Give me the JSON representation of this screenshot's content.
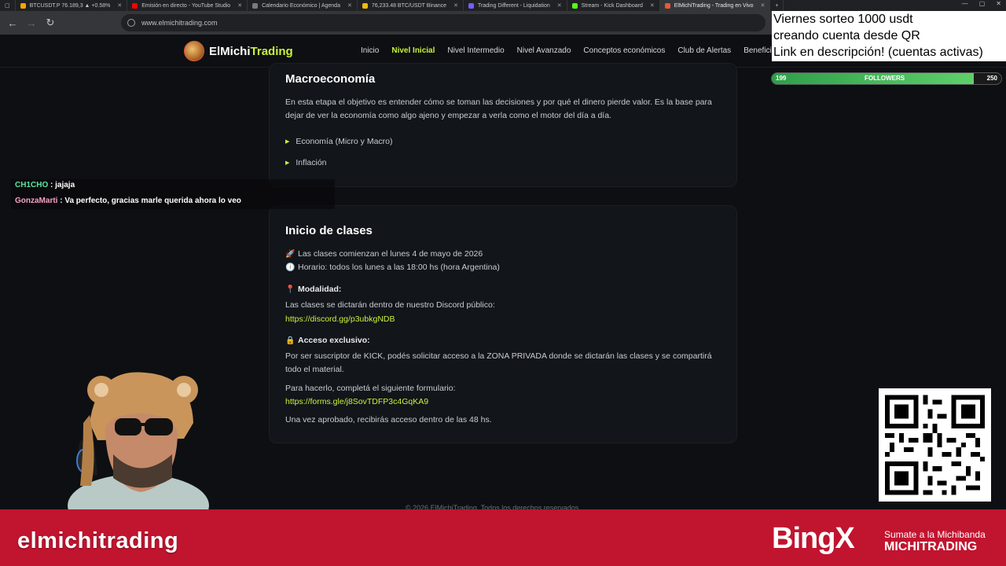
{
  "browser": {
    "tabs": [
      {
        "label": "BTCUSDT.P 76.189,3 ▲ +0.58%",
        "color": "#f7a600"
      },
      {
        "label": "Emisión en directo - YouTube Studio",
        "color": "#ff0000"
      },
      {
        "label": "Calendario Económico | Agenda",
        "color": "#888888"
      },
      {
        "label": "76,233.48 BTC/USDT Binance",
        "color": "#f0b90b"
      },
      {
        "label": "Trading Different - Liquidation",
        "color": "#7a5cff"
      },
      {
        "label": "Stream - Kick Dashboard",
        "color": "#53fc18"
      },
      {
        "label": "ElMichiTrading - Trading en Vivo",
        "color": "#e35a3a"
      }
    ],
    "url": "www.elmichitrading.com"
  },
  "site": {
    "logo_main": "ElMichi",
    "logo_accent": "Trading",
    "nav": [
      "Inicio",
      "Nivel Inicial",
      "Nivel Intermedio",
      "Nivel Avanzado",
      "Conceptos económicos",
      "Club de Alertas",
      "Beneficios"
    ],
    "active_nav_index": 1
  },
  "macro": {
    "title": "Macroeconomía",
    "text": "En esta etapa el objetivo es entender cómo se toman las decisiones y por qué el dinero pierde valor. Es la base para dejar de ver la economía como algo ajeno y empezar a verla como el motor del día a día.",
    "items": [
      "Economía (Micro y Macro)",
      "Inflación"
    ]
  },
  "classes": {
    "title": "Inicio de clases",
    "start": "Las clases comienzan el lunes 4 de mayo de 2026",
    "schedule": "Horario: todos los lunes a las 18:00 hs (hora Argentina)",
    "modality_label": "Modalidad:",
    "modality_text": "Las clases se dictarán dentro de nuestro Discord público:",
    "discord_link": "https://discord.gg/p3ubkgNDB",
    "exclusive_label": "Acceso exclusivo:",
    "exclusive_text": "Por ser suscriptor de KICK, podés solicitar acceso a la ZONA PRIVADA donde se dictarán las clases y se compartirá todo el material.",
    "form_intro": "Para hacerlo, completá el siguiente formulario:",
    "form_link": "https://forms.gle/j8SovTDFP3c4GqKA9",
    "approval": "Una vez aprobado, recibirás acceso dentro de las 48 hs."
  },
  "footer": "© 2026 ElMichiTrading. Todos los derechos reservados.",
  "chat": [
    {
      "user": "CH1CHO",
      "message": ": jajaja"
    },
    {
      "user": "GonzaMarti",
      "message": ": Va perfecto, gracias marle querida ahora lo veo"
    }
  ],
  "promo": {
    "line1": "Viernes sorteo 1000 usdt",
    "line2": "creando cuenta desde QR",
    "line3": "Link en descripción! (cuentas activas)"
  },
  "followers": {
    "label": "FOLLOWERS",
    "current": "199",
    "goal": "250",
    "fraction": 0.88
  },
  "banner": {
    "channel": "elmichitrading",
    "brand": "BingX",
    "sponsor_line1": "Sumate a la Michibanda",
    "sponsor_line2": "MICHITRADING"
  },
  "colors": {
    "accent": "#c7f23b",
    "banner": "#c1142f"
  }
}
